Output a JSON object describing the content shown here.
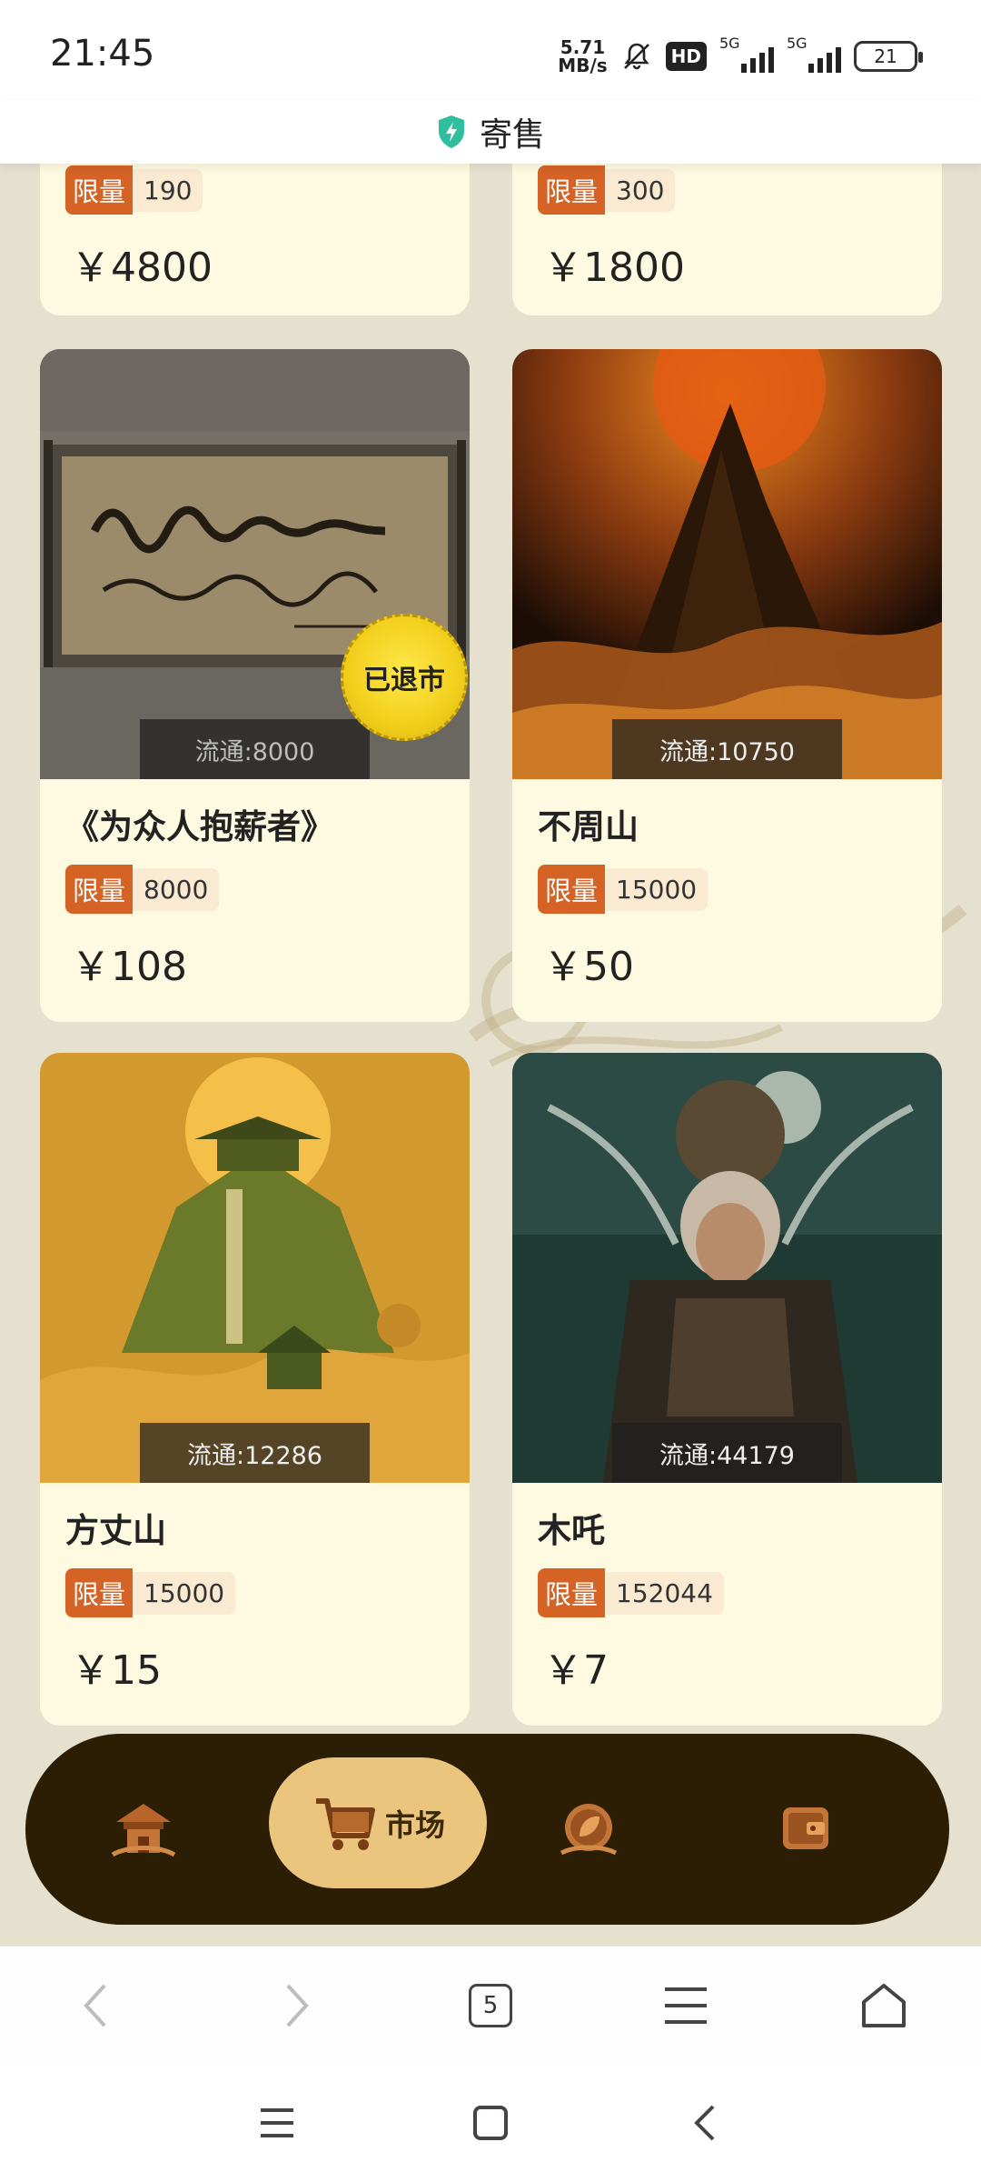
{
  "status_bar": {
    "time": "21:45",
    "net_speed_value": "5.71",
    "net_speed_unit": "MB/s",
    "hd_label": "HD",
    "signal_1": "5G",
    "signal_2": "5G",
    "battery": "21"
  },
  "header": {
    "title": "寄售",
    "icon": "shield-icon"
  },
  "cards": [
    {
      "title": "",
      "limit_label": "限量",
      "limit": "190",
      "price": "￥4800"
    },
    {
      "title": "",
      "limit_label": "限量",
      "limit": "300",
      "price": "￥1800"
    },
    {
      "title": "《为众人抱薪者》",
      "limit_label": "限量",
      "limit": "8000",
      "price": "￥108",
      "circulation": "流通:8000",
      "badge": "已退市"
    },
    {
      "title": "不周山",
      "limit_label": "限量",
      "limit": "15000",
      "price": "￥50",
      "circulation": "流通:10750"
    },
    {
      "title": "方丈山",
      "limit_label": "限量",
      "limit": "15000",
      "price": "￥15",
      "circulation": "流通:12286"
    },
    {
      "title": "木吒",
      "limit_label": "限量",
      "limit": "152044",
      "price": "￥7",
      "circulation": "流通:44179"
    }
  ],
  "bottom_nav": {
    "items": [
      {
        "icon": "pavilion-icon"
      },
      {
        "icon": "cart-icon",
        "label": "市场",
        "active": true
      },
      {
        "icon": "leaf-coin-icon"
      },
      {
        "icon": "wallet-icon"
      }
    ]
  },
  "browser": {
    "tab_count": "5"
  },
  "colors": {
    "limit_tag": "#d46325",
    "nav_bg": "#2b1e05",
    "nav_active": "#ebc57e",
    "card_bg": "#fefae2",
    "page_bg": "#e6e1cf"
  }
}
